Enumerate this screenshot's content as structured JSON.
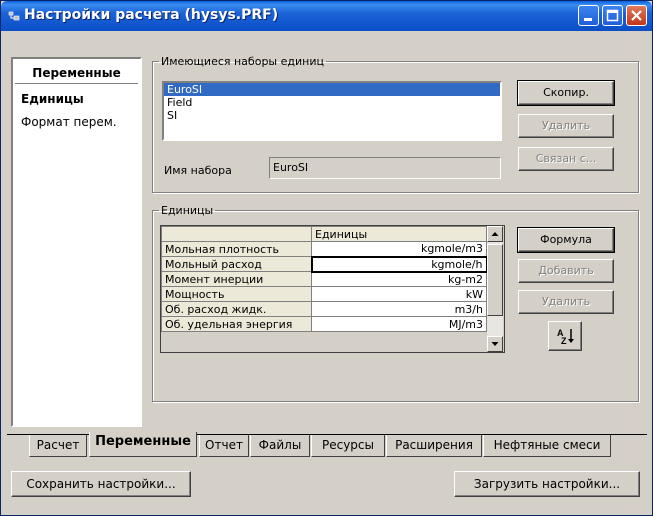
{
  "window": {
    "title": "Настройки расчета (hysys.PRF)"
  },
  "left_panel": {
    "header": "Переменные",
    "items": [
      {
        "label": "Единицы",
        "selected": true
      },
      {
        "label": "Формат перем.",
        "selected": false
      }
    ]
  },
  "unit_sets": {
    "group_label": "Имеющиеся наборы единиц",
    "items": [
      {
        "label": "EuroSI",
        "selected": true
      },
      {
        "label": "Field",
        "selected": false
      },
      {
        "label": "SI",
        "selected": false
      }
    ],
    "copy_button": "Скопир.",
    "delete_button": "Удалить",
    "linked_button": "Связан с...",
    "name_label": "Имя набора",
    "name_value": "EuroSI"
  },
  "units": {
    "group_label": "Единицы",
    "column_header": "Единицы",
    "rows": [
      {
        "variable": "Мольная плотность",
        "unit": "kgmole/m3"
      },
      {
        "variable": "Мольный расход",
        "unit": "kgmole/h"
      },
      {
        "variable": "Момент инерции",
        "unit": "kg-m2"
      },
      {
        "variable": "Мощность",
        "unit": "kW"
      },
      {
        "variable": "Об. расход жидк.",
        "unit": "m3/h"
      },
      {
        "variable": "Об. удельная энергия",
        "unit": "MJ/m3"
      }
    ],
    "formula_button": "Формула",
    "add_button": "Добавить",
    "delete_button": "Удалить",
    "sort_button": "AZ"
  },
  "tabs": [
    {
      "label": "Расчет",
      "active": false
    },
    {
      "label": "Переменные",
      "active": true
    },
    {
      "label": "Отчет",
      "active": false
    },
    {
      "label": "Файлы",
      "active": false
    },
    {
      "label": "Ресурсы",
      "active": false
    },
    {
      "label": "Расширения",
      "active": false
    },
    {
      "label": "Нефтяные смеси",
      "active": false
    }
  ],
  "footer": {
    "save_button": "Сохранить настройки...",
    "load_button": "Загрузить настройки..."
  },
  "colors": {
    "title_bar": "#0b4ec6",
    "selection": "#316ac5",
    "face": "#d4d0c8",
    "close_button": "#c2361b"
  }
}
